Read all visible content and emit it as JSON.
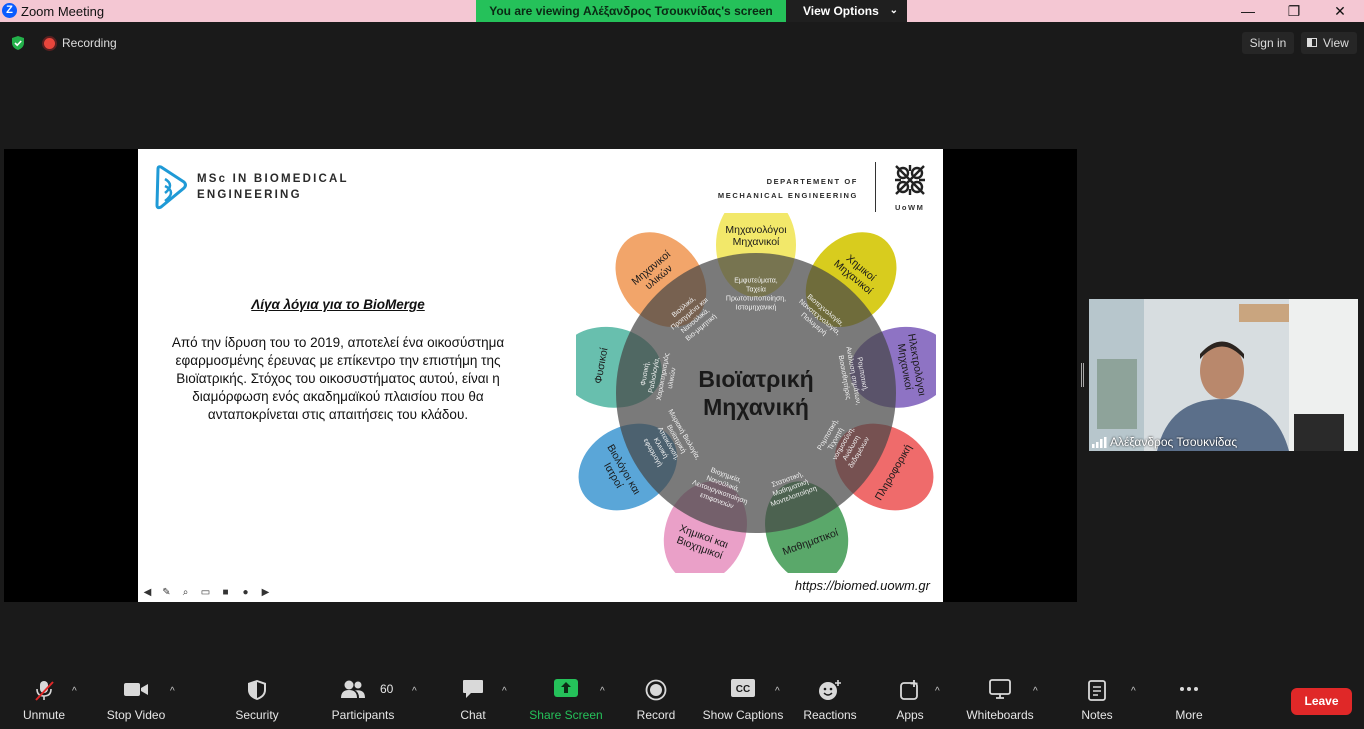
{
  "titlebar": {
    "app_title": "Zoom Meeting",
    "app_logo_letter": "Z",
    "viewing_banner": "You are viewing Αλέξανδρος Τσουκνίδας's screen",
    "view_options_label": "View Options",
    "minimize_glyph": "—",
    "restore_glyph": "❐",
    "close_glyph": "✕"
  },
  "status": {
    "recording_label": "Recording",
    "sign_in_label": "Sign in",
    "view_label": "View"
  },
  "slide": {
    "program_title_line1": "MSc IN BIOMEDICAL",
    "program_title_line2": "ENGINEERING",
    "department_line1": "DEPARTEMENT OF",
    "department_line2": "MECHANICAL ENGINEERING",
    "university_label": "UoWM",
    "about_heading": "Λίγα λόγια για το BioMerge",
    "about_body": "Από την ίδρυση του το 2019, αποτελεί ένα οικοσύστημα εφαρμοσμένης έρευνας με επίκεντρο την επιστήμη της Βιοϊατρικής. Στόχος του οικοσυστήματος αυτού, είναι η διαμόρφωση ενός ακαδημαϊκού πλαισίου που θα ανταποκρίνεται στις απαιτήσεις του κλάδου.",
    "center_line1": "Βιοϊατρική",
    "center_line2": "Μηχανική",
    "url": "https://biomed.uowm.gr",
    "petals": [
      {
        "outer": [
          "Μηχανολόγοι",
          "Μηχανικοί"
        ],
        "inner": [
          "Εμφυτεύματα,",
          "Ταχεία",
          "Πρωτοτυποποίηση,",
          "Ιστομηχανική"
        ],
        "color": "#f2e86a"
      },
      {
        "outer": [
          "Χημικοί",
          "Μηχανικοί"
        ],
        "inner": [
          "Βιοτεχνολογία,",
          "Νανοτεχνολογία,",
          "Πολυμερή"
        ],
        "color": "#d8cc1e"
      },
      {
        "outer": [
          "Ηλεκτρολόγοι",
          "Μηχανικοί"
        ],
        "inner": [
          "Ρομποτική,",
          "Ανάλυση σημάτων,",
          "Βιοαισθητήρες"
        ],
        "color": "#8e73c4"
      },
      {
        "outer": [
          "Πληροφορική"
        ],
        "inner": [
          "Ρομποτική,",
          "Τεχνητή",
          "νοημοσύνη,",
          "Ανάλυση",
          "δεδομένων"
        ],
        "color": "#ef6b6b"
      },
      {
        "outer": [
          "Μαθηματικοί"
        ],
        "inner": [
          "Στατιστική,",
          "Μαθηματική",
          "Μοντελοποίηση"
        ],
        "color": "#5aa86a"
      },
      {
        "outer": [
          "Χημικοί και",
          "Βιοχημικοί"
        ],
        "inner": [
          "Βιοχημεία,",
          "Νανοϋλικά,",
          "Λειτουργικοποίηση",
          "επιφανειών"
        ],
        "color": "#eaa0c8"
      },
      {
        "outer": [
          "Βιολόγοι και",
          "Ιατροί"
        ],
        "inner": [
          "Μοριακή Βιολογία,",
          "Βιοϊατρική",
          "Απεικόνιση,",
          "Κλινική",
          "εφαρμογή"
        ],
        "color": "#5aa6d8"
      },
      {
        "outer": [
          "Φυσικοί"
        ],
        "inner": [
          "Φυσική,",
          "Ραδιολογία,",
          "Χαρακτηρισμός",
          "υλικών"
        ],
        "color": "#68bfae"
      },
      {
        "outer": [
          "Μηχανικοί",
          "υλικών"
        ],
        "inner": [
          "Βιοϋλικά,",
          "Προηγμένα και",
          "Νανοϋλικά,",
          "Βιο-μιμητική"
        ],
        "color": "#f2a56a"
      }
    ]
  },
  "video": {
    "participant_name": "Αλέξανδρος Τσουκνίδας"
  },
  "toolbar": {
    "unmute": "Unmute",
    "stop_video": "Stop Video",
    "security": "Security",
    "participants": "Participants",
    "participants_count": "60",
    "chat": "Chat",
    "share_screen": "Share Screen",
    "record": "Record",
    "show_captions": "Show Captions",
    "reactions": "Reactions",
    "apps": "Apps",
    "whiteboards": "Whiteboards",
    "notes": "Notes",
    "more": "More",
    "leave": "Leave",
    "cc_icon_text": "CC"
  },
  "colors": {
    "share_green": "#25c15a",
    "leave_red": "#e02828",
    "center_circle": "rgba(70,70,70,0.72)"
  }
}
